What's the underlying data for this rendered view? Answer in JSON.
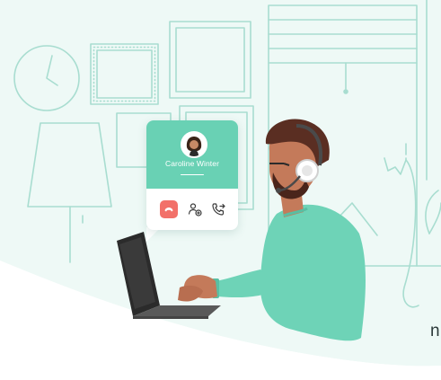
{
  "call_card": {
    "caller_name": "Caroline Winter",
    "avatar_icon": "woman-avatar-icon",
    "actions": [
      {
        "name": "end-call",
        "icon": "phone-hangup-icon",
        "color": "#f27069"
      },
      {
        "name": "transfer-call",
        "icon": "transfer-users-icon"
      },
      {
        "name": "forward-call",
        "icon": "phone-forward-icon"
      }
    ],
    "accent_color": "#69d1b4"
  },
  "caption": {
    "text": "n"
  },
  "colors": {
    "background_tint": "#edf8f5",
    "line_art": "#a8ddd0",
    "shirt": "#6ed3b7",
    "laptop": "#2b2b2b"
  }
}
